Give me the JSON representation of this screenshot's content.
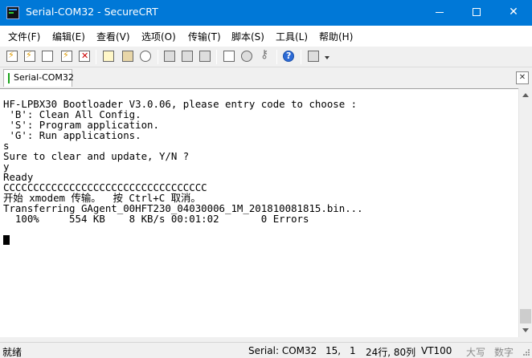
{
  "window": {
    "title": "Serial-COM32 - SecureCRT",
    "controls": {
      "minimize": "minimize-icon",
      "maximize": "maximize-icon",
      "close": "close-icon"
    }
  },
  "menu": {
    "items": [
      "文件(F)",
      "编辑(E)",
      "查看(V)",
      "选项(O)",
      "传输(T)",
      "脚本(S)",
      "工具(L)",
      "帮助(H)"
    ]
  },
  "toolbar": {
    "icons": [
      "connect-icon",
      "quick-connect-icon",
      "connect-tab-icon",
      "reconnect-icon",
      "disconnect-icon",
      "copy-icon",
      "paste-icon",
      "find-icon",
      "print-icon",
      "print-selection-icon",
      "printer-setup-icon",
      "session-options-icon",
      "global-options-icon",
      "keymap-icon",
      "help-icon",
      "sftp-icon"
    ]
  },
  "tabs": {
    "active_label": "Serial-COM32",
    "active_indicator_color": "#1aa31a"
  },
  "terminal": {
    "lines": [
      "HF-LPBX30 Bootloader V3.0.06, please entry code to choose :",
      " 'B': Clean All Config.",
      " 'S': Program application.",
      " 'G': Run applications.",
      "s",
      "Sure to clear and update, Y/N ?",
      "y",
      "Ready",
      "CCCCCCCCCCCCCCCCCCCCCCCCCCCCCCCCCC",
      "开始 xmodem 传输。  按 Ctrl+C 取消。",
      "Transferring GAgent_00HFT230_04030006_1M_201810081815.bin...",
      "  100%     554 KB    8 KB/s 00:01:02       0 Errors"
    ]
  },
  "status": {
    "ready": "就绪",
    "session": "Serial: COM32",
    "row": "15,",
    "col": "1",
    "size": "24行, 80列",
    "emulation": "VT100",
    "caps": "大写",
    "num": "数字"
  },
  "colors": {
    "titlebar": "#0078d7",
    "terminal_bg": "#ffffff",
    "terminal_fg": "#000000"
  }
}
